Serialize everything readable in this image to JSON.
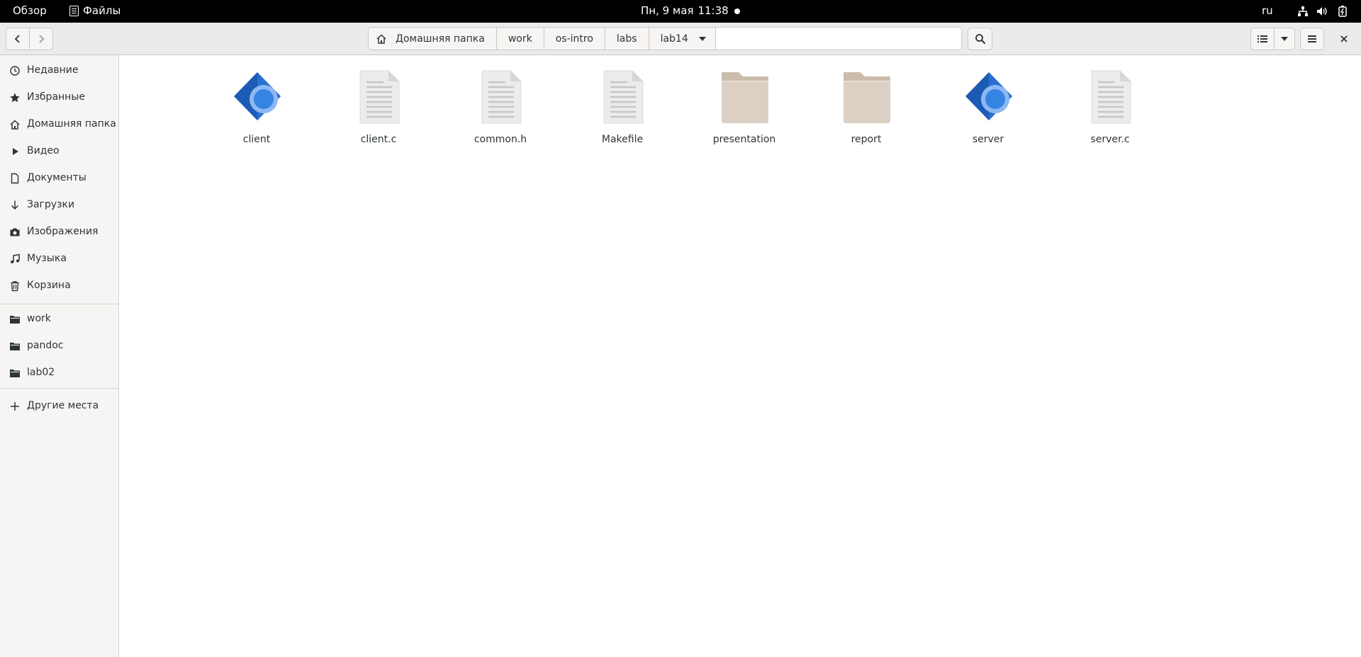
{
  "topbar": {
    "activities": "Обзор",
    "app_name": "Файлы",
    "date": "Пн, 9 мая",
    "time": "11:38",
    "lang": "ru",
    "icons": [
      "network-icon",
      "volume-icon",
      "battery-icon"
    ]
  },
  "header": {
    "back_icon": "chevron-left-icon",
    "forward_icon": "chevron-right-icon",
    "path": [
      "Домашняя папка",
      "work",
      "os-intro",
      "labs",
      "lab14"
    ],
    "search_icon": "search-icon",
    "view_icon": "list-view-icon",
    "view_menu_icon": "dropdown-arrow-icon",
    "menu_icon": "hamburger-icon",
    "close_icon": "close-icon"
  },
  "sidebar": {
    "places": [
      {
        "label": "Недавние",
        "icon": "clock-icon"
      },
      {
        "label": "Избранные",
        "icon": "star-icon"
      },
      {
        "label": "Домашняя папка",
        "icon": "home-icon"
      },
      {
        "label": "Видео",
        "icon": "video-icon"
      },
      {
        "label": "Документы",
        "icon": "document-icon"
      },
      {
        "label": "Загрузки",
        "icon": "download-icon"
      },
      {
        "label": "Изображения",
        "icon": "camera-icon"
      },
      {
        "label": "Музыка",
        "icon": "music-icon"
      },
      {
        "label": "Корзина",
        "icon": "trash-icon"
      }
    ],
    "bookmarks": [
      {
        "label": "work",
        "icon": "folder-icon"
      },
      {
        "label": "pandoc",
        "icon": "folder-icon"
      },
      {
        "label": "lab02",
        "icon": "folder-icon"
      }
    ],
    "other": {
      "label": "Другие места",
      "icon": "plus-icon"
    }
  },
  "files": [
    {
      "name": "client",
      "type": "executable"
    },
    {
      "name": "client.c",
      "type": "text"
    },
    {
      "name": "common.h",
      "type": "text"
    },
    {
      "name": "Makefile",
      "type": "text"
    },
    {
      "name": "presentation",
      "type": "folder"
    },
    {
      "name": "report",
      "type": "folder"
    },
    {
      "name": "server",
      "type": "executable"
    },
    {
      "name": "server.c",
      "type": "text"
    }
  ],
  "colors": {
    "folder": "#dcd0c4",
    "folder_tab": "#cbbcab",
    "exec_dark": "#1c5bb5",
    "exec_light": "#3584e4",
    "doc_page": "#ececec",
    "doc_lines": "#c6c6c6"
  }
}
